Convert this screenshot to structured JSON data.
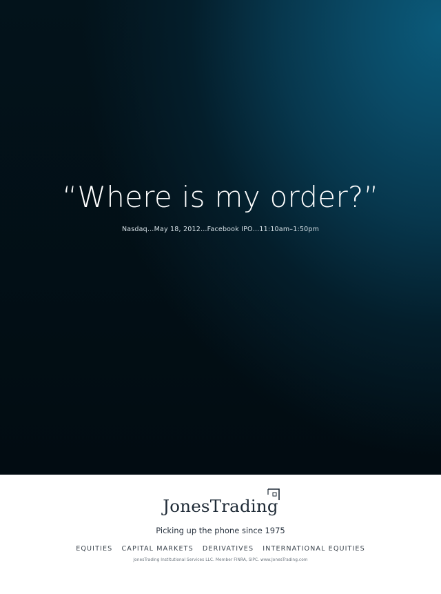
{
  "ad": {
    "headline": "“Where is my order?”",
    "subline": "Nasdaq…May 18, 2012…Facebook IPO…11:10am–1:50pm"
  },
  "brand": {
    "logo_text": "JonesTrading",
    "logo_mark_icon": "corner-bracket-icon",
    "tagline": "Picking up the phone since 1975",
    "services": [
      "EQUITIES",
      "CAPITAL MARKETS",
      "DERIVATIVES",
      "INTERNATIONAL EQUITIES"
    ],
    "legal": "JonesTrading Institutional Services LLC.  Member FINRA, SIPC.  www.JonesTrading.com"
  },
  "colors": {
    "hero_dark": "#020c12",
    "hero_accent": "#0b5a7a",
    "headline": "#ffffff",
    "logo": "#1e2a36"
  }
}
